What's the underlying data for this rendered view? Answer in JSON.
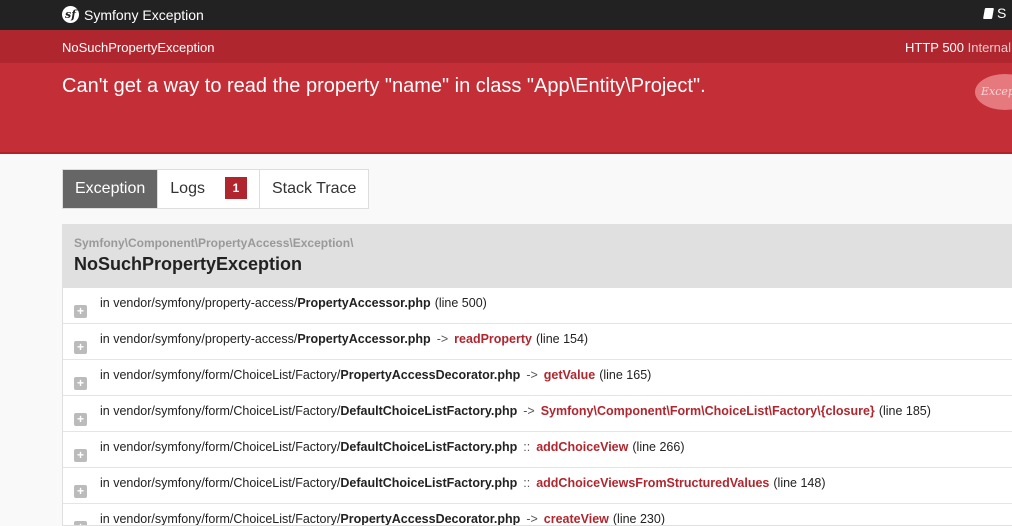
{
  "topbar": {
    "title": "Symfony Exception",
    "logo_glyph": "sf",
    "right_label": "S"
  },
  "header": {
    "exception_class": "NoSuchPropertyException",
    "status_code": "HTTP 500",
    "status_text": "Internal",
    "message": "Can't get a way to read the property \"name\" in class \"App\\Entity\\Project\".",
    "illustration_text": "Exception"
  },
  "tabs": [
    {
      "label": "Exception",
      "active": true
    },
    {
      "label": "Logs",
      "badge": "1"
    },
    {
      "label": "Stack Trace"
    }
  ],
  "trace": {
    "namespace": "Symfony\\Component\\PropertyAccess\\Exception\\",
    "class_name": "NoSuchPropertyException",
    "frames": [
      {
        "prefix": "in vendor/symfony/property-access/",
        "file": "PropertyAccessor.php",
        "sep": "",
        "function": "",
        "line": "(line 500)"
      },
      {
        "prefix": "in vendor/symfony/property-access/",
        "file": "PropertyAccessor.php",
        "sep": "->",
        "function": "readProperty",
        "line": "(line 154)"
      },
      {
        "prefix": "in vendor/symfony/form/ChoiceList/Factory/",
        "file": "PropertyAccessDecorator.php",
        "sep": "->",
        "function": "getValue",
        "line": "(line 165)"
      },
      {
        "prefix": "in vendor/symfony/form/ChoiceList/Factory/",
        "file": "DefaultChoiceListFactory.php",
        "sep": "->",
        "function": "Symfony\\Component\\Form\\ChoiceList\\Factory\\{closure}",
        "line": "(line 185)"
      },
      {
        "prefix": "in vendor/symfony/form/ChoiceList/Factory/",
        "file": "DefaultChoiceListFactory.php",
        "sep": "::",
        "function": "addChoiceView",
        "line": "(line 266)"
      },
      {
        "prefix": "in vendor/symfony/form/ChoiceList/Factory/",
        "file": "DefaultChoiceListFactory.php",
        "sep": "::",
        "function": "addChoiceViewsFromStructuredValues",
        "line": "(line 148)"
      },
      {
        "prefix": "in vendor/symfony/form/ChoiceList/Factory/",
        "file": "PropertyAccessDecorator.php",
        "sep": "->",
        "function": "createView",
        "line": "(line 230)"
      }
    ],
    "expand_glyph": "+"
  },
  "colors": {
    "accent": "#c42e36",
    "accent_dark": "#b0262e",
    "topbar": "#222222"
  }
}
